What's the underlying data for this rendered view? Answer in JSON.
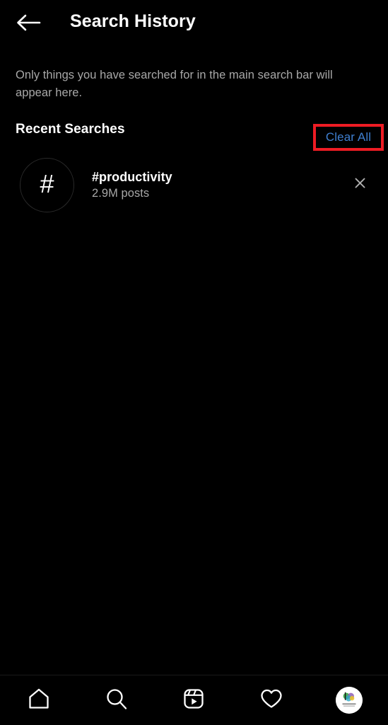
{
  "app": {
    "theme": "dark",
    "background_color": "#000000",
    "accent_link_color": "#3f7fd0",
    "highlight_color": "#ee1c24",
    "muted_text_color": "#a8a8a8"
  },
  "header": {
    "title": "Search History",
    "back_icon": "arrow-left-icon"
  },
  "description": {
    "text": "Only things you have searched for in the main search bar will appear here."
  },
  "recent_searches": {
    "section_title": "Recent Searches",
    "clear_all_label": "Clear All",
    "clear_all_highlighted": true,
    "items": [
      {
        "avatar_glyph": "#",
        "avatar_type": "hashtag-avatar",
        "title": "#productivity",
        "subtitle": "2.9M posts",
        "remove_icon": "close-icon"
      }
    ]
  },
  "bottom_nav": {
    "items": [
      {
        "name": "home",
        "icon": "home-icon",
        "active": false
      },
      {
        "name": "search",
        "icon": "search-icon",
        "active": false
      },
      {
        "name": "reels",
        "icon": "reels-icon",
        "active": false
      },
      {
        "name": "activity",
        "icon": "heart-icon",
        "active": false
      },
      {
        "name": "profile",
        "icon": "profile-avatar-icon",
        "active": false
      }
    ],
    "profile_logo_colors": [
      "#3aa94b",
      "#2aa7c4",
      "#8e5fb5",
      "#e8c22e"
    ]
  }
}
